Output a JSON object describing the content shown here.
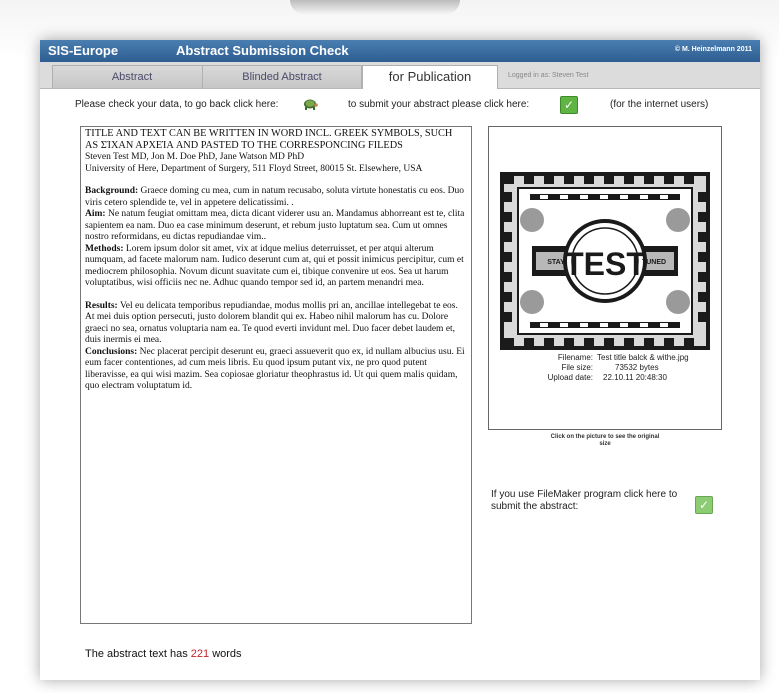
{
  "header": {
    "app_name": "SIS-Europe",
    "page_title": "Abstract Submission Check",
    "copyright": "© M. Heinzelmann 2011"
  },
  "tabs": [
    {
      "label": "Abstract",
      "active": false
    },
    {
      "label": "Blinded Abstract",
      "active": false
    },
    {
      "label": "for Publication",
      "active": true
    }
  ],
  "logged_in": "Logged in as: Steven Test",
  "check_bar": {
    "go_back_text": "Please check your data, to go back click here:",
    "go_back_icon": "turtle-icon",
    "submit_text": "to submit your abstract please click here:",
    "submit_icon": "checkmark-icon",
    "internet_users_note": "(for the internet users)"
  },
  "abstract": {
    "title_lines": [
      "TITLE AND TEXT CAN BE WRITTEN IN WORD INCL.  GREEK SYMBOLS, SUCH",
      "AS ΣΊΧΑΝ ΑΡΧΕΊΑ AND PASTED TO THE CORRESPONCING FILEDS"
    ],
    "authors": "Steven Test MD, Jon M. Doe PhD, Jane Watson MD PhD",
    "affiliation": "University of Here, Department of Surgery, 511 Floyd Street, 80015 St. Elsewhere, USA",
    "sections": [
      {
        "label": "Background:",
        "text": " Graece doming cu mea, cum in natum recusabo, soluta virtute honestatis cu eos. Duo viris cetero splendide te, vel in appetere delicatissimi. ."
      },
      {
        "label": "Aim:",
        "text": " Ne natum feugiat omittam mea, dicta dicant viderer usu an. Mandamus abhorreant est te, clita sapientem ea nam. Duo ea case minimum deserunt, et rebum justo luptatum sea. Cum ut omnes nostro reformidans, eu dictas repudiandae vim.."
      },
      {
        "label": "Methods:",
        "text": " Lorem ipsum dolor sit amet, vix at idque melius deterruisset, et per atqui alterum numquam, ad facete malorum nam. Iudico deserunt cum at, qui et possit inimicus percipitur, cum et mediocrem philosophia. Novum dicunt suavitate cum ei, tibique convenire ut eos. Sea ut harum voluptatibus, wisi officiis nec ne. Adhuc quando tempor sed id, an partem menandri mea."
      },
      {
        "label": "Results:",
        "text": " Vel eu delicata temporibus repudiandae, modus mollis pri an, ancillae intellegebat te eos. At mei duis option persecuti, justo dolorem blandit qui ex. Habeo nihil malorum has cu. Dolore graeci no sea, ornatus voluptaria nam ea. Te quod everti invidunt mel. Duo facer debet laudem et, duis inermis ei mea."
      },
      {
        "label": "Conclusions:",
        "text": " Nec placerat percipit deserunt eu, graeci assueverit quo ex, id nullam albucius usu. Ei eum facer contentiones, ad cum meis libris. Eu quod ipsum putant vix, ne pro quod putent liberavisse, ea qui wisi mazim. Sea copiosae gloriatur theophrastus id. Ut qui quem malis quidam, quo electram voluptatum id."
      }
    ]
  },
  "image_preview": {
    "image_text": {
      "center": "TEST",
      "left": "STAY",
      "right": "TUNED"
    },
    "filename_label": "Filename:",
    "filename": "Test title balck & withe.jpg",
    "filesize_label": "File size:",
    "filesize": "73532 bytes",
    "upload_label": "Upload date:",
    "upload_date": "22.10.11 20:48:30",
    "click_note": "Click on the picture to see the original size"
  },
  "filemaker": {
    "text": "If you use FileMaker program click here to submit the abstract:",
    "icon": "checkmark-icon"
  },
  "word_count": {
    "prefix": "The abstract text has",
    "count": "221",
    "suffix": "words"
  },
  "colors": {
    "header_blue": "#2d5d91",
    "submit_green": "#5fb443",
    "count_red": "#c0262b"
  }
}
